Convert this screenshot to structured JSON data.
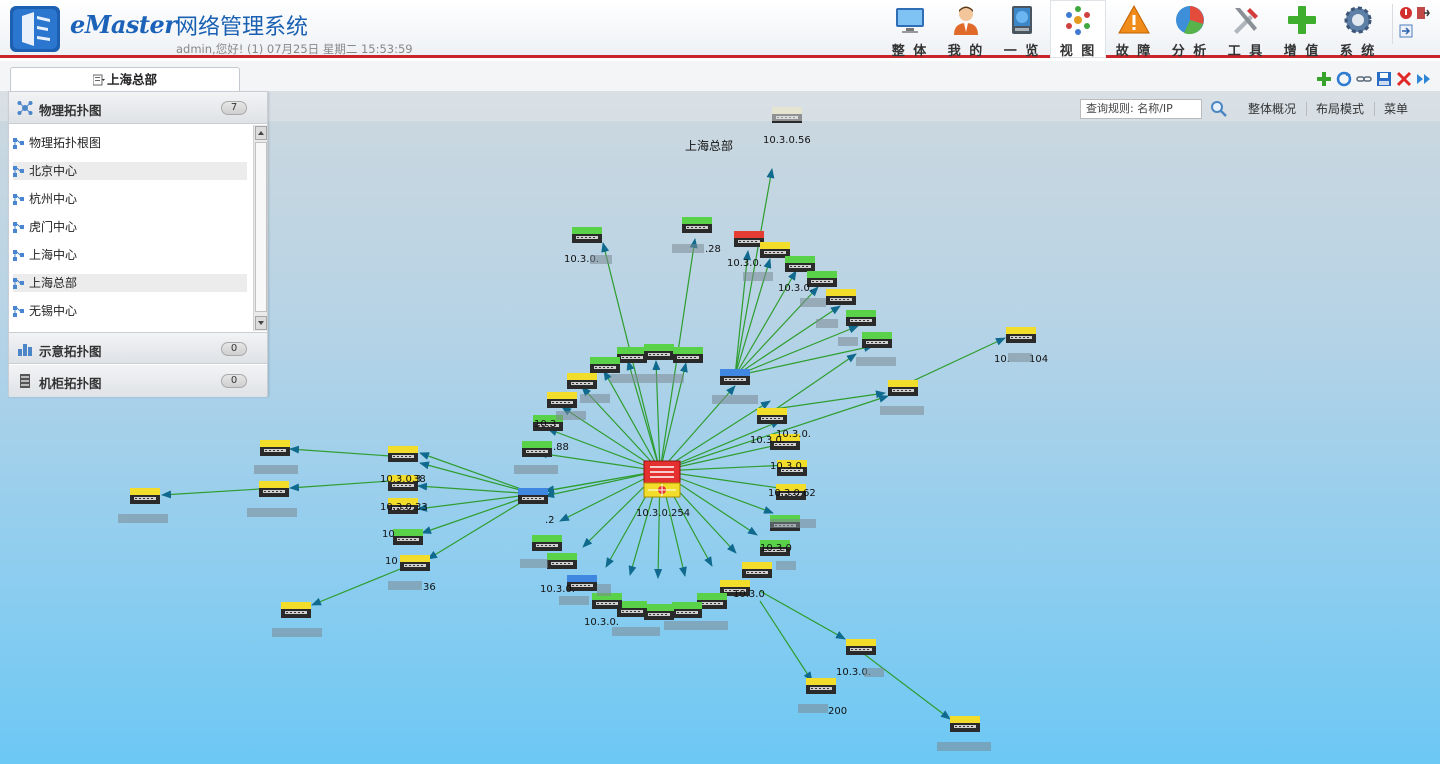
{
  "header": {
    "logo_text": "eMaster",
    "title": "网络管理系统",
    "user_status": "admin,您好! (1) 07月25日 星期二 15:53:59"
  },
  "nav": [
    {
      "label": "整 体",
      "icon": "monitor-icon"
    },
    {
      "label": "我 的",
      "icon": "user-icon"
    },
    {
      "label": "一 览",
      "icon": "server-icon"
    },
    {
      "label": "视 图",
      "icon": "dots-icon",
      "active": true
    },
    {
      "label": "故 障",
      "icon": "warning-icon"
    },
    {
      "label": "分 析",
      "icon": "pie-chart-icon"
    },
    {
      "label": "工 具",
      "icon": "tools-icon"
    },
    {
      "label": "增 值",
      "icon": "plus-icon"
    },
    {
      "label": "系 统",
      "icon": "gear-icon"
    }
  ],
  "tab": {
    "label": "上海总部"
  },
  "canvas_toolbar": {
    "search_placeholder": "查询规则: 名称/IP",
    "overview": "整体概况",
    "layout": "布局模式",
    "menu": "菜单"
  },
  "left_panel": {
    "physical": {
      "label": "物理拓扑图",
      "count": "7"
    },
    "tree": [
      "物理拓扑根图",
      "北京中心",
      "杭州中心",
      "虎门中心",
      "上海中心",
      "上海总部",
      "无锡中心"
    ],
    "schematic": {
      "label": "示意拓扑图",
      "count": "0"
    },
    "cabinet": {
      "label": "机柜拓扑图",
      "count": "0"
    }
  },
  "topology": {
    "caption": "上海总部",
    "core_label": "10.3.0.254",
    "top_label": "10.3.0.56",
    "labels": {
      "l1": "10.3.0.",
      "l2": "10.3.0.",
      "l3": "10.3.0.",
      "l4": "10.3.0.3",
      "l5": "10.3.0.33",
      "l6": "10.3.0.62",
      "l7": "10.3.0.",
      "l8": "10.3.0.",
      "l9": "10.3.0.",
      "l10": "10.3.0.",
      "l11": "10.3.0",
      "l12": "10.3.0.",
      "l13": "10.3.0",
      "l14": "104",
      "l15": "200",
      "l16": "36",
      "l17": "38",
      "l18": "10",
      "l19": "10",
      "l20": "10.",
      "l21": ".88",
      "l22": "10.3",
      "l23": ".28",
      "l24": "10.3.0.",
      "l25": ".2"
    }
  }
}
